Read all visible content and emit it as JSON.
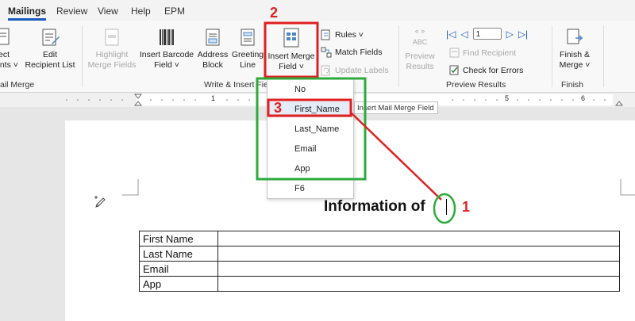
{
  "tabs": [
    "Mailings",
    "Review",
    "View",
    "Help",
    "EPM"
  ],
  "ribbon": {
    "select_recipients": {
      "line1": "ect",
      "line2": "ents ˅"
    },
    "edit_recipient_list": {
      "line1": "Edit",
      "line2": "Recipient List"
    },
    "highlight_merge_fields": {
      "line1": "Highlight",
      "line2": "Merge Fields"
    },
    "insert_barcode_field": {
      "line1": "Insert Barcode",
      "line2": "Field ˅"
    },
    "address_block": {
      "line1": "Address",
      "line2": "Block"
    },
    "greeting_line": {
      "line1": "Greeting",
      "line2": "Line"
    },
    "insert_merge_field": {
      "line1": "Insert Merge",
      "line2": "Field ˅"
    },
    "rules": "Rules ˅",
    "match_fields": "Match Fields",
    "update_labels": "Update Labels",
    "preview_results": {
      "line1": "Preview",
      "line2": "Results",
      "badge": "ABC"
    },
    "record_number": "1",
    "find_recipient": "Find Recipient",
    "check_for_errors": "Check for Errors",
    "finish_merge": {
      "line1": "Finish &",
      "line2": "Merge ˅"
    },
    "groups": {
      "start_mail_merge": "ail Merge",
      "write_insert": "Write & Insert Fie",
      "preview_results": "Preview Results",
      "finish": "Finish"
    }
  },
  "ruler": {
    "marks": [
      "1",
      "5",
      "6"
    ]
  },
  "dropdown": {
    "items": [
      "No",
      "First_Name",
      "Last_Name",
      "Email",
      "App",
      "F6"
    ],
    "tooltip": "Insert Mail Merge Field"
  },
  "document": {
    "heading": "Information of",
    "table": [
      [
        "First Name",
        ""
      ],
      [
        "Last Name",
        ""
      ],
      [
        "Email",
        ""
      ],
      [
        "App",
        ""
      ]
    ]
  },
  "annotations": {
    "step1": "1",
    "step2": "2",
    "step3": "3"
  },
  "colors": {
    "accent": "#185abd",
    "annotation_red": "#e02020",
    "annotation_green": "#2eaa3c"
  }
}
